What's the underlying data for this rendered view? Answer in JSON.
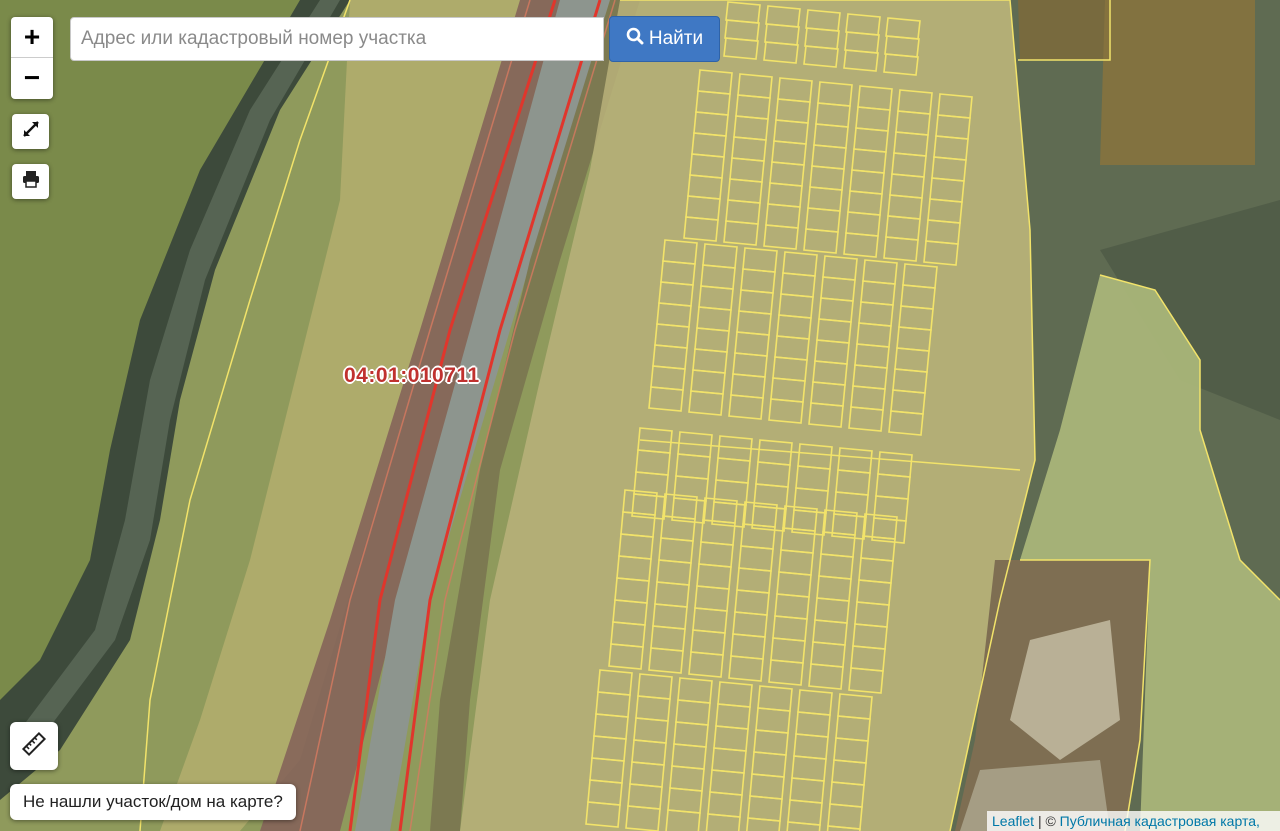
{
  "map": {
    "zoom_in_label": "+",
    "zoom_out_label": "−",
    "cadastral_label": "04:01:010711"
  },
  "search": {
    "placeholder": "Адрес или кадастровый номер участка",
    "value": "",
    "button_label": "Найти"
  },
  "footer": {
    "not_found_label": "Не нашли участок/дом на карте?"
  },
  "attribution": {
    "leaflet_link": "Leaflet",
    "separator": "| ©",
    "source_link": "Публичная кадастровая карта,"
  },
  "colors": {
    "accent": "#3f78c4",
    "parcel_outline": "#f2e36a",
    "road_line": "#e0362c",
    "cadastral_text": "#c0312f"
  },
  "icons": [
    "fullscreen-icon",
    "print-icon",
    "search-icon",
    "ruler-icon"
  ]
}
